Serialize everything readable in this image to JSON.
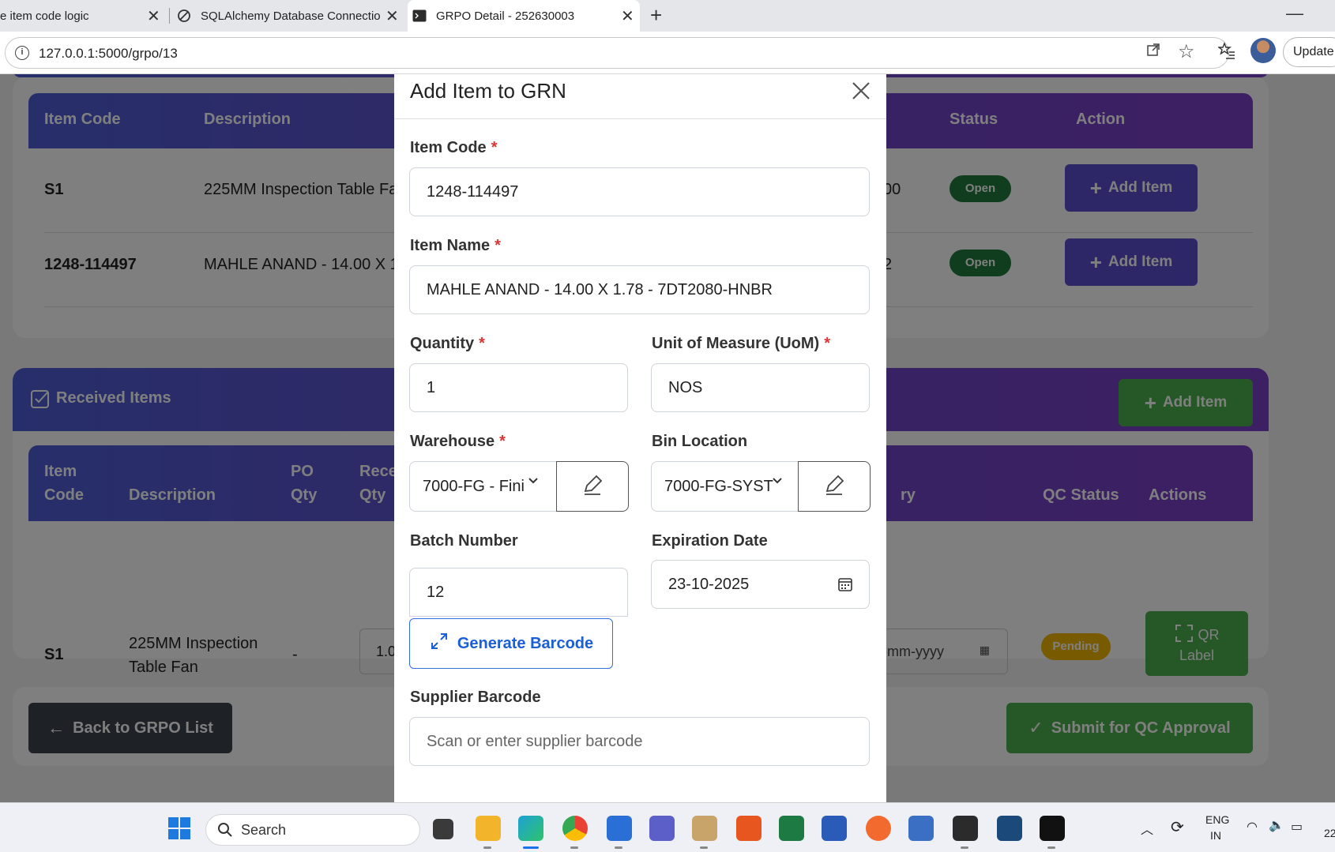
{
  "browser": {
    "tabs": [
      {
        "label": "e item code logic",
        "active": false
      },
      {
        "label": "SQLAlchemy Database Connectio",
        "active": false
      },
      {
        "label": "GRPO Detail - 252630003",
        "active": true
      }
    ],
    "url": "127.0.0.1:5000/grpo/13",
    "update_label": "Update"
  },
  "po_table": {
    "headers": [
      "Item Code",
      "Description",
      "Status",
      "Action"
    ],
    "rows": [
      {
        "code": "S1",
        "desc": "225MM Inspection Table Fa",
        "qty_frag": "00",
        "status": "Open",
        "action": "Add Item"
      },
      {
        "code": "1248-114497",
        "desc": "MAHLE ANAND - 14.00 X 1",
        "qty_frag": "2",
        "status": "Open",
        "action": "Add Item"
      }
    ]
  },
  "received": {
    "title": "Received Items",
    "add_label": "Add Item",
    "headers": {
      "item_code_1": "Item",
      "item_code_2": "Code",
      "description": "Description",
      "po_qty_1": "PO",
      "po_qty_2": "Qty",
      "rec_qty_1": "Rece",
      "rec_qty_2": "Qty",
      "expiry_frag": "ry",
      "qc_status": "QC Status",
      "actions": "Actions"
    },
    "row": {
      "code": "S1",
      "desc_1": "225MM Inspection",
      "desc_2": "Table Fan",
      "po_qty": "-",
      "rec_qty": "1.0",
      "date_placeholder": "d-mm-yyyy",
      "qc_status": "Pending",
      "qr_1": "QR",
      "qr_2": "Label"
    }
  },
  "footer": {
    "back_label": "Back to GRPO List",
    "submit_label": "Submit for QC Approval"
  },
  "modal": {
    "title": "Add Item to GRN",
    "item_code": {
      "label": "Item Code",
      "value": "1248-114497"
    },
    "item_name": {
      "label": "Item Name",
      "value": "MAHLE ANAND - 14.00 X 1.78 - 7DT2080-HNBR"
    },
    "quantity": {
      "label": "Quantity",
      "value": "1"
    },
    "uom": {
      "label": "Unit of Measure (UoM)",
      "value": "NOS"
    },
    "warehouse": {
      "label": "Warehouse",
      "value": "7000-FG - Fini"
    },
    "bin": {
      "label": "Bin Location",
      "value": "7000-FG-SYST"
    },
    "batch": {
      "label": "Batch Number",
      "value": "12"
    },
    "expiry": {
      "label": "Expiration Date",
      "value": "23-10-2025"
    },
    "generate_label": "Generate Barcode",
    "supplier_barcode": {
      "label": "Supplier Barcode",
      "placeholder": "Scan or enter supplier barcode"
    },
    "required_mark": "*"
  },
  "taskbar": {
    "search_label": "Search",
    "lang_1": "ENG",
    "lang_2": "IN",
    "clock_frag": "22"
  },
  "colors": {
    "header_gradient_start": "#4e5ed6",
    "header_gradient_end": "#7b3fc6",
    "open_badge": "#1e7a3c",
    "pending_badge": "#f0b400",
    "green_button": "#4cae4c",
    "link_blue": "#1a5fd6",
    "required_red": "#d33"
  }
}
